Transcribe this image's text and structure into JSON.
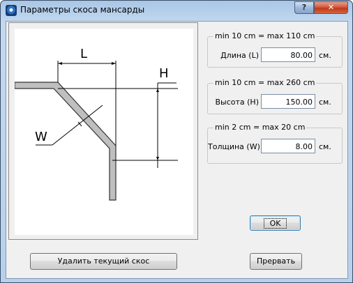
{
  "window": {
    "title": "Параметры скоса мансарды",
    "help_label": "?",
    "close_label": "✕"
  },
  "sketch": {
    "label_l": "L",
    "label_h": "H",
    "label_w": "W"
  },
  "fields": {
    "length": {
      "range": "min 10 cm = max 110 cm",
      "label": "Длина (L)",
      "value": "80.00",
      "unit": "см."
    },
    "height": {
      "range": "min 10 cm = max 260 cm",
      "label": "Высота (H)",
      "value": "150.00",
      "unit": "см."
    },
    "thickness": {
      "range": "min 2 cm = max 20 cm",
      "label": "Толщина (W)",
      "value": "8.00",
      "unit": "см."
    }
  },
  "buttons": {
    "ok": "OK",
    "delete": "Удалить текущий скос",
    "cancel": "Прервать"
  }
}
